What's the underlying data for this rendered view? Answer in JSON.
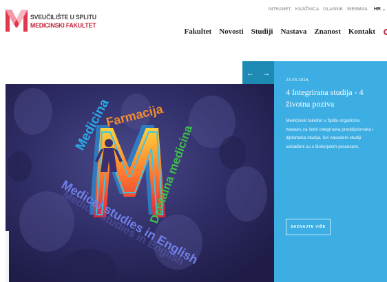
{
  "logo": {
    "line1": "SVEUČILIŠTE U SPLITU",
    "line2": "MEDICINSKI FAKULTET",
    "icon": "mf-logo-icon"
  },
  "utility": {
    "links": [
      "INTRANET",
      "KNJIŽNICA",
      "GLASNIK",
      "WEBMAIL"
    ],
    "language": "HR"
  },
  "nav": {
    "items": [
      "Fakultet",
      "Novosti",
      "Studiji",
      "Nastava",
      "Znanost",
      "Kontakt"
    ],
    "search_icon": "search-icon"
  },
  "slide": {
    "date": "23.03.2016.",
    "title": "4 Integrirana studija - 4 životna poziva",
    "body": "Medicinski fakultet u Splitu organizira nastavu za četiri integrirana preddiplomska i diplomska studija. Svi navedeni studiji usklađeni su s Bolonjskim procesom.",
    "button": "SAZNAJTE VIŠE",
    "prev_icon": "arrow-left-icon",
    "next_icon": "arrow-right-icon"
  },
  "hero": {
    "words": [
      "Medicina",
      "Farmacija",
      "Dentalna medicina",
      "Medical studies in English"
    ],
    "letter": "M"
  },
  "colors": {
    "brand_red": "#c3213a",
    "panel_blue": "#3daee3",
    "arrow_blue": "#1d8ab3",
    "hero_navy": "#2e2c62"
  }
}
